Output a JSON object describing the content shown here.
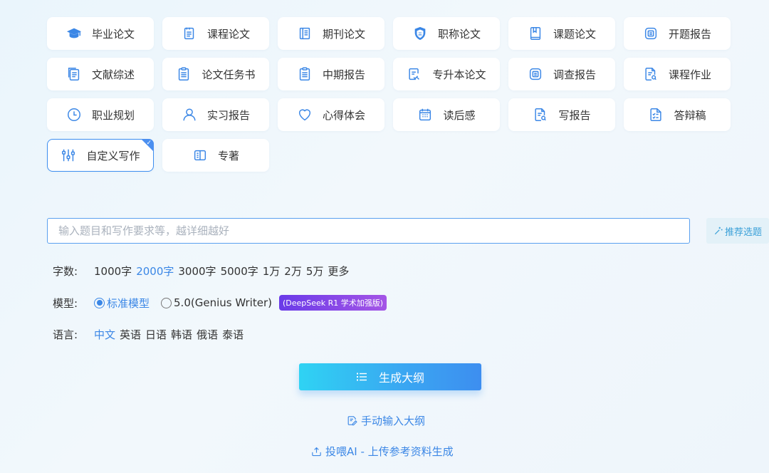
{
  "categories": [
    {
      "label": "毕业论文",
      "icon": "graduation-cap-icon"
    },
    {
      "label": "课程论文",
      "icon": "document-icon"
    },
    {
      "label": "期刊论文",
      "icon": "journal-icon"
    },
    {
      "label": "职称论文",
      "icon": "shield-badge-icon"
    },
    {
      "label": "课题论文",
      "icon": "book-icon"
    },
    {
      "label": "开题报告",
      "icon": "report-icon"
    },
    {
      "label": "文献综述",
      "icon": "document-stack-icon"
    },
    {
      "label": "论文任务书",
      "icon": "clipboard-icon"
    },
    {
      "label": "中期报告",
      "icon": "clipboard-list-icon"
    },
    {
      "label": "专升本论文",
      "icon": "document-edit-icon"
    },
    {
      "label": "调查报告",
      "icon": "report-icon"
    },
    {
      "label": "课程作业",
      "icon": "document-search-icon"
    },
    {
      "label": "职业规划",
      "icon": "clock-icon"
    },
    {
      "label": "实习报告",
      "icon": "user-icon"
    },
    {
      "label": "心得体会",
      "icon": "heart-icon"
    },
    {
      "label": "读后感",
      "icon": "calendar-icon"
    },
    {
      "label": "写报告",
      "icon": "document-search-icon"
    },
    {
      "label": "答辩稿",
      "icon": "checklist-icon"
    },
    {
      "label": "自定义写作",
      "icon": "sliders-icon",
      "selected": true
    },
    {
      "label": "专著",
      "icon": "open-book-icon"
    }
  ],
  "input": {
    "placeholder": "输入题目和写作要求等，越详细越好",
    "value": ""
  },
  "recommend_label": "推荐选题",
  "word_count": {
    "label": "字数:",
    "options": [
      "1000字",
      "2000字",
      "3000字",
      "5000字",
      "1万",
      "2万",
      "5万",
      "更多"
    ],
    "selected": "2000字"
  },
  "model": {
    "label": "模型:",
    "options": [
      {
        "label": "标准模型",
        "checked": true
      },
      {
        "label": "5.0(Genius Writer)",
        "checked": false
      }
    ],
    "badge": "(DeepSeek R1 学术加强版)"
  },
  "language": {
    "label": "语言:",
    "options": [
      "中文",
      "英语",
      "日语",
      "韩语",
      "俄语",
      "泰语"
    ],
    "selected": "中文"
  },
  "generate_label": "生成大纲",
  "manual_outline_label": "手动输入大纲",
  "upload_label": "投喂AI - 上传参考资料生成",
  "colors": {
    "accent": "#3b87e6",
    "badge_start": "#6a3be8",
    "badge_end": "#a455e6",
    "button_start": "#2fd3f3",
    "button_end": "#3d8ef0"
  }
}
